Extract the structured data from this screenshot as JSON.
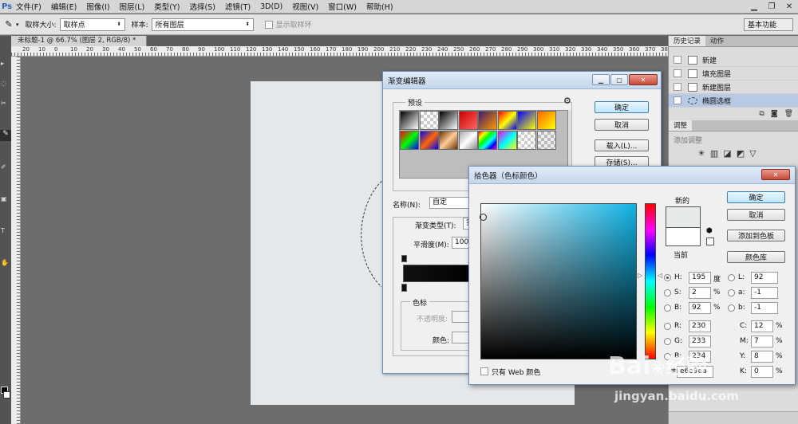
{
  "menubar": {
    "logo": "Ps",
    "items": [
      "文件(F)",
      "编辑(E)",
      "图像(I)",
      "图层(L)",
      "类型(Y)",
      "选择(S)",
      "滤镜(T)",
      "3D(D)",
      "视图(V)",
      "窗口(W)",
      "帮助(H)"
    ]
  },
  "options": {
    "sample_size_label": "取样大小:",
    "sample_size_value": "取样点",
    "sample_label": "样本:",
    "sample_value": "所有图层",
    "show_ring_label": "显示取样环",
    "workspace": "基本功能"
  },
  "document": {
    "tab_title": "未标题-1 @ 66.7% (图层 2, RGB/8) *",
    "ruler_numbers": [
      "20",
      "10",
      "0",
      "10",
      "20",
      "30",
      "40",
      "50",
      "60",
      "70",
      "80",
      "90",
      "100",
      "110",
      "120",
      "130",
      "140",
      "150",
      "160",
      "170",
      "180",
      "190",
      "200",
      "210",
      "220",
      "230",
      "240",
      "250",
      "260",
      "270",
      "280",
      "290",
      "300",
      "310",
      "320",
      "330",
      "340",
      "350",
      "360",
      "370",
      "380"
    ]
  },
  "history_panel": {
    "tabs": [
      "历史记录",
      "动作"
    ],
    "items": [
      "新建",
      "填充图层",
      "新建图层",
      "椭圆选框"
    ]
  },
  "adjust_panel": {
    "tab": "调整",
    "title": "添加调整"
  },
  "gradient_editor": {
    "title": "渐变编辑器",
    "presets_label": "预设",
    "ok": "确定",
    "cancel": "取消",
    "load": "载入(L)...",
    "save": "存储(S)...",
    "name_label": "名称(N):",
    "name_value": "自定",
    "type_label": "渐变类型(T):",
    "type_value": "实",
    "smooth_label": "平滑度(M):",
    "smooth_value": "100",
    "stops_label": "色标",
    "opacity_label": "不透明度:",
    "color_label": "颜色:"
  },
  "color_picker": {
    "title": "拾色器（色标颜色）",
    "ok": "确定",
    "cancel": "取消",
    "add_swatch": "添加到色板",
    "libraries": "颜色库",
    "new_label": "新的",
    "current_label": "当前",
    "web_only": "只有 Web 颜色",
    "hex_prefix": "#",
    "hex": "e6e9ea",
    "fields": {
      "H": {
        "label": "H:",
        "value": "195",
        "unit": "度"
      },
      "S": {
        "label": "S:",
        "value": "2",
        "unit": "%"
      },
      "B": {
        "label": "B:",
        "value": "92",
        "unit": "%"
      },
      "R": {
        "label": "R:",
        "value": "230"
      },
      "G": {
        "label": "G:",
        "value": "233"
      },
      "Bl": {
        "label": "B:",
        "value": "234"
      },
      "L": {
        "label": "L:",
        "value": "92"
      },
      "a": {
        "label": "a:",
        "value": "-1"
      },
      "b": {
        "label": "b:",
        "value": "-1"
      },
      "C": {
        "label": "C:",
        "value": "12",
        "unit": "%"
      },
      "M": {
        "label": "M:",
        "value": "7",
        "unit": "%"
      },
      "Y": {
        "label": "Y:",
        "value": "8",
        "unit": "%"
      },
      "K": {
        "label": "K:",
        "value": "0",
        "unit": "%"
      }
    },
    "new_color": "#e6e9ea",
    "current_color": "#ffffff"
  },
  "watermark": {
    "brand": "Bai",
    "brand2": "经验",
    "url": "jingyan.baidu.com"
  }
}
